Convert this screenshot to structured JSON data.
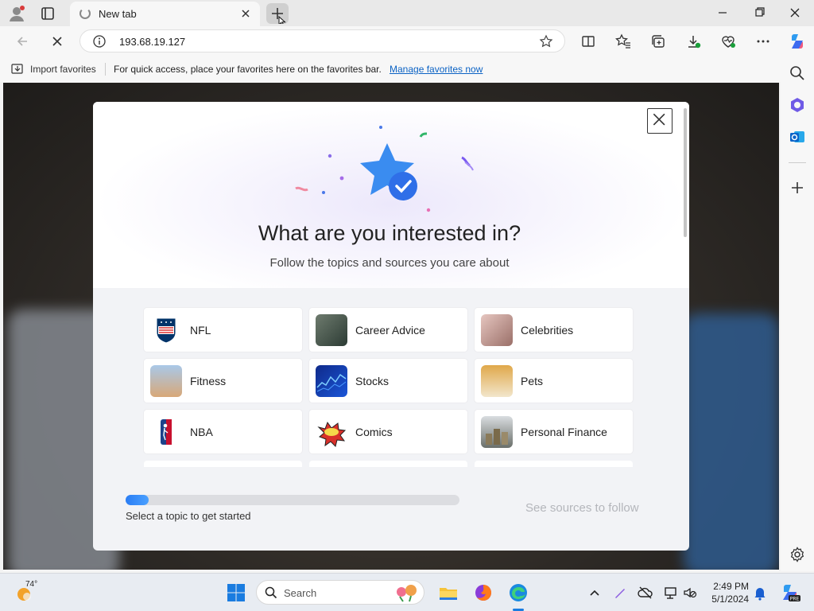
{
  "browser": {
    "tab": {
      "title": "New tab"
    },
    "address": "193.68.19.127"
  },
  "favorites_bar": {
    "import_label": "Import favorites",
    "message": "For quick access, place your favorites here on the favorites bar.",
    "link": "Manage favorites now"
  },
  "modal": {
    "title": "What are you interested in?",
    "subtitle": "Follow the topics and sources you care about",
    "topics": [
      {
        "label": "NFL"
      },
      {
        "label": "Career Advice"
      },
      {
        "label": "Celebrities"
      },
      {
        "label": "Fitness"
      },
      {
        "label": "Stocks"
      },
      {
        "label": "Pets"
      },
      {
        "label": "NBA"
      },
      {
        "label": "Comics"
      },
      {
        "label": "Personal Finance"
      }
    ],
    "progress_percent": 7,
    "progress_text": "Select a topic to get started",
    "next_label": "See sources to follow"
  },
  "taskbar": {
    "weather_temp": "74°",
    "search_placeholder": "Search",
    "time": "2:49 PM",
    "date": "5/1/2024"
  },
  "colors": {
    "accent": "#2a7df4",
    "link": "#0b62c4"
  }
}
